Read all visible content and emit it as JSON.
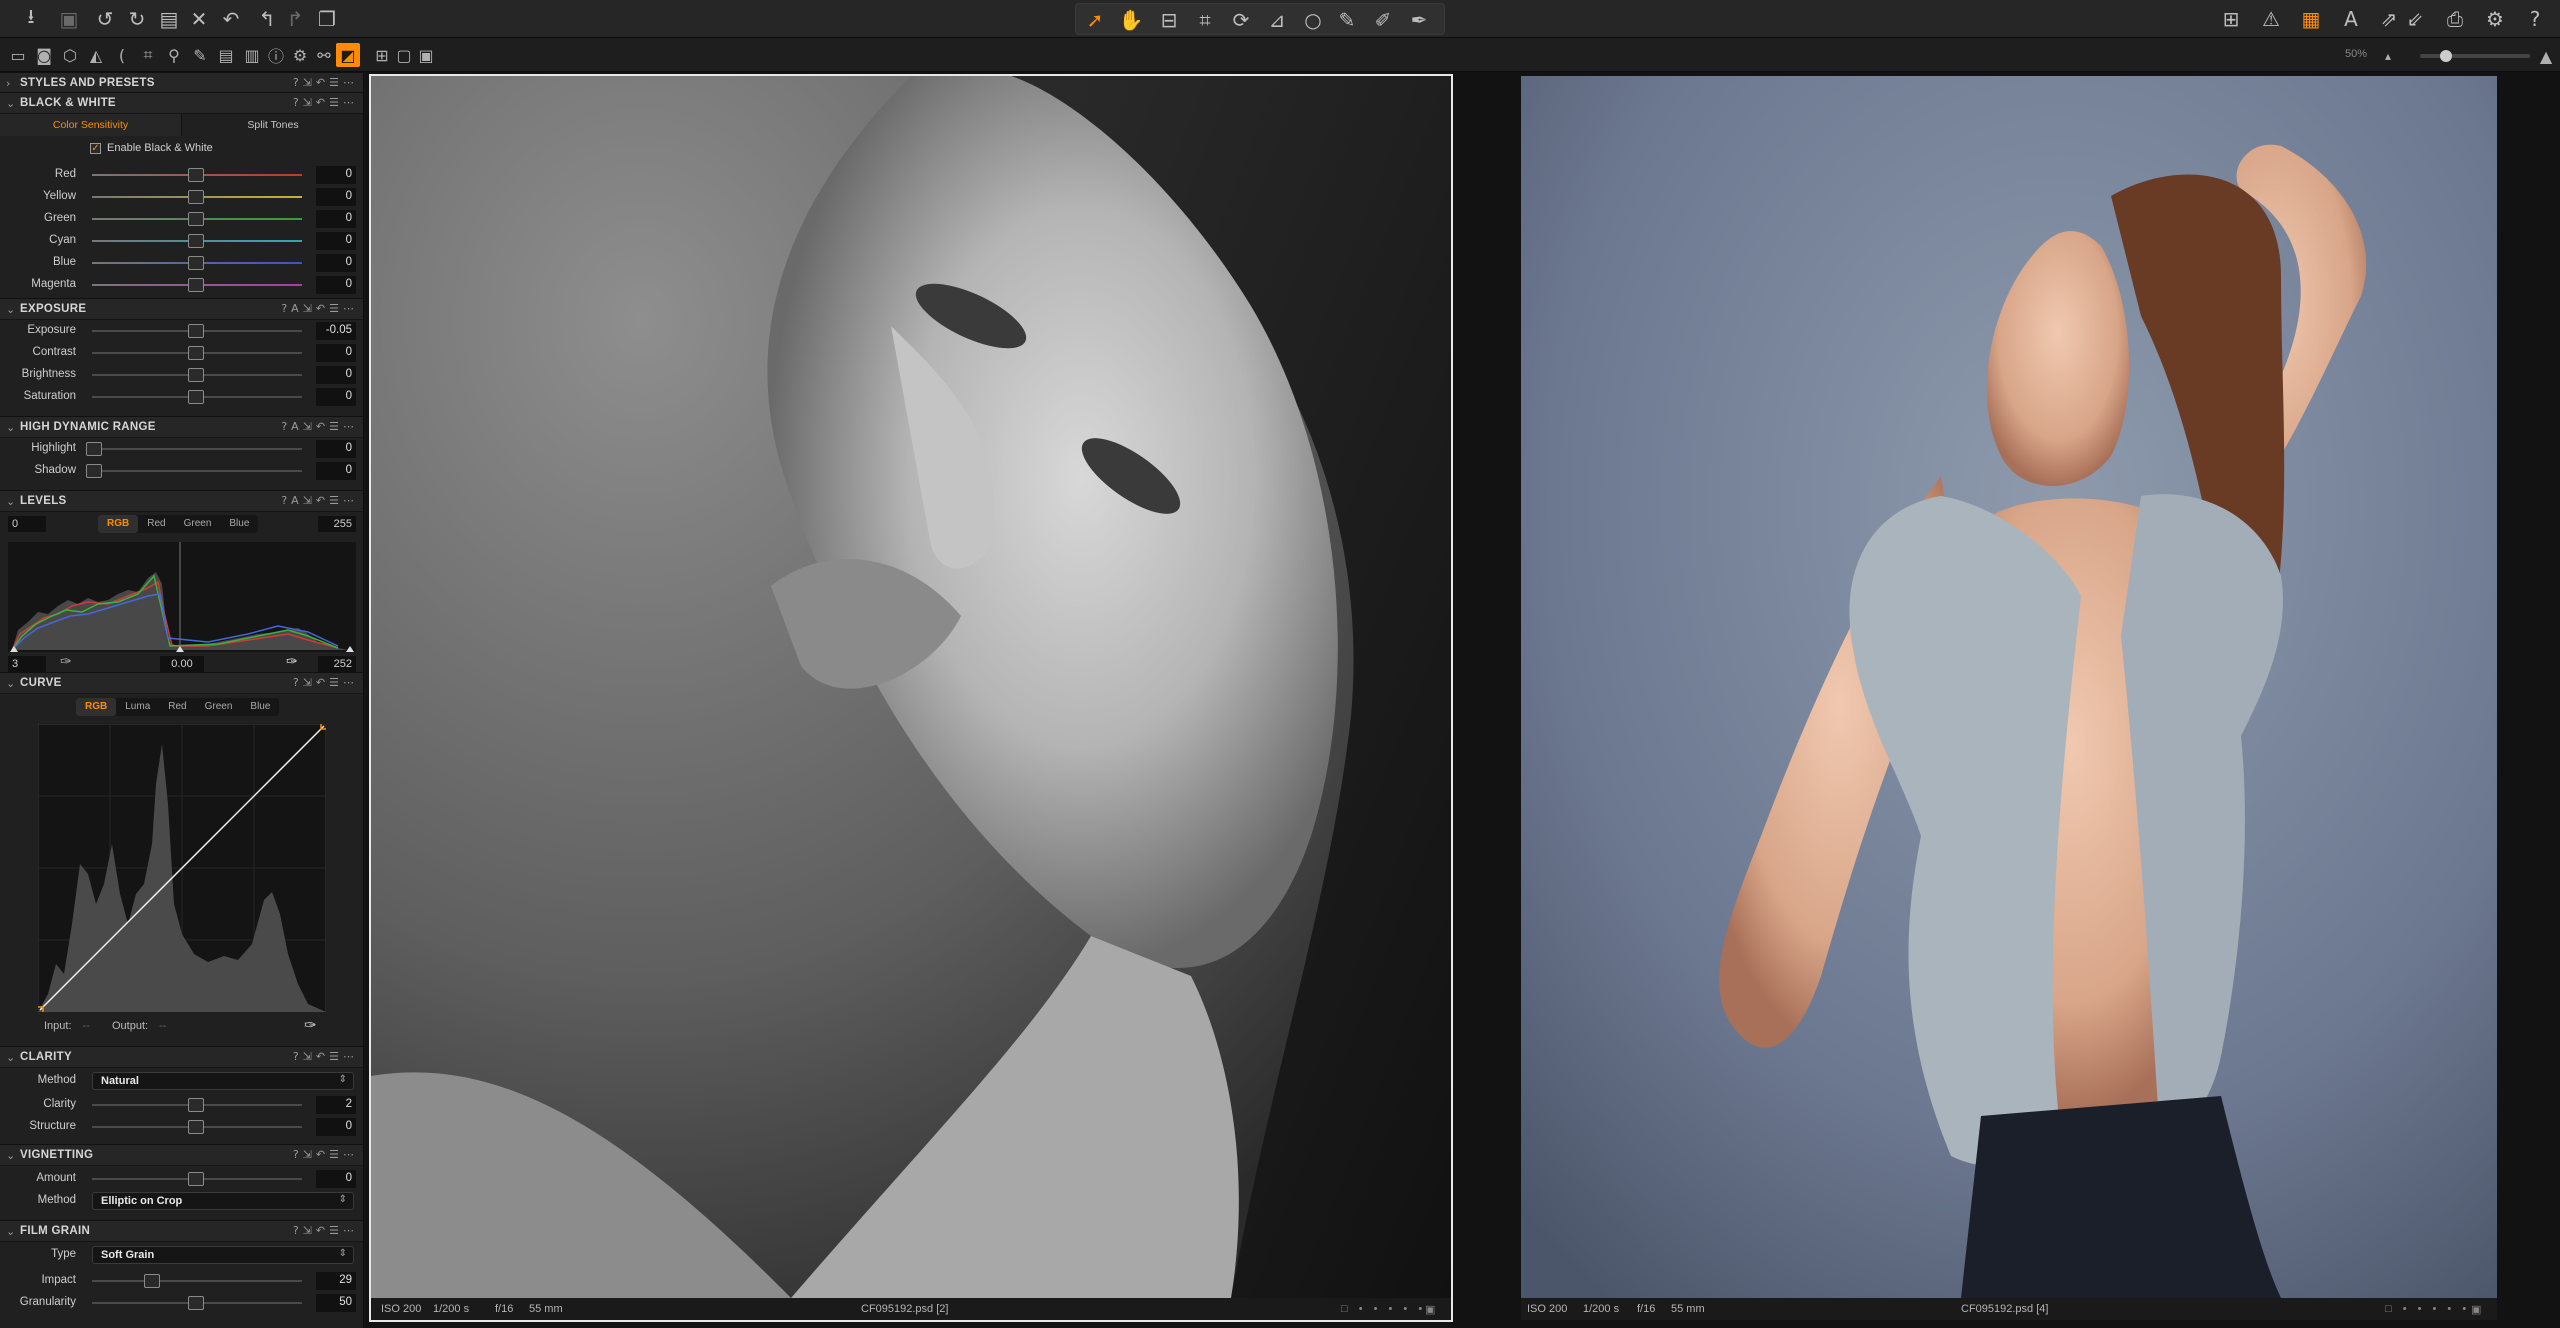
{
  "toolbar": {
    "left_icons": [
      "import-icon",
      "camera-icon",
      "rotate-left-icon",
      "rotate-right-icon",
      "folder-icon",
      "delete-icon",
      "undo-icon",
      "back-icon",
      "forward-icon",
      "duplicate-icon"
    ],
    "cursor_tools": [
      "select-cursor-icon",
      "pan-cursor-icon",
      "straighten-icon",
      "crop-icon",
      "rotate-icon",
      "keystone-icon",
      "spot-icon",
      "brush-icon",
      "eraser-icon",
      "picker-icon"
    ],
    "right_icons": [
      "grid-icon",
      "warning-icon",
      "overlay-icon",
      "text-icon",
      "expand-icon",
      "collapse-icon",
      "print-icon",
      "settings-icon",
      "help-icon"
    ]
  },
  "subbar": {
    "zoom_label": "50%"
  },
  "panel": {
    "styles": {
      "title": "STYLES AND PRESETS"
    },
    "bw": {
      "title": "BLACK & WHITE",
      "tabs": [
        "Color Sensitivity",
        "Split Tones"
      ],
      "enable_label": "Enable Black & White",
      "sliders": [
        {
          "label": "Red",
          "value": "0",
          "color": "#c0392b"
        },
        {
          "label": "Yellow",
          "value": "0",
          "color": "#c9b52b"
        },
        {
          "label": "Green",
          "value": "0",
          "color": "#3c9a3c"
        },
        {
          "label": "Cyan",
          "value": "0",
          "color": "#2fa7b4"
        },
        {
          "label": "Blue",
          "value": "0",
          "color": "#3b55c8"
        },
        {
          "label": "Magenta",
          "value": "0",
          "color": "#b03aa8"
        }
      ]
    },
    "exposure": {
      "title": "EXPOSURE",
      "sliders": [
        {
          "label": "Exposure",
          "value": "-0.05"
        },
        {
          "label": "Contrast",
          "value": "0"
        },
        {
          "label": "Brightness",
          "value": "0"
        },
        {
          "label": "Saturation",
          "value": "0"
        }
      ]
    },
    "hdr": {
      "title": "HIGH DYNAMIC RANGE",
      "sliders": [
        {
          "label": "Highlight",
          "value": "0"
        },
        {
          "label": "Shadow",
          "value": "0"
        }
      ]
    },
    "levels": {
      "title": "LEVELS",
      "left_value": "0",
      "right_value": "255",
      "tabs": [
        "RGB",
        "Red",
        "Green",
        "Blue"
      ],
      "bottom_left": "3",
      "bottom_mid": "0.00",
      "bottom_right": "252"
    },
    "curve": {
      "title": "CURVE",
      "tabs": [
        "RGB",
        "Luma",
        "Red",
        "Green",
        "Blue"
      ],
      "input_label": "Input:",
      "input_value": "--",
      "output_label": "Output:",
      "output_value": "--"
    },
    "clarity": {
      "title": "CLARITY",
      "method_label": "Method",
      "method_value": "Natural",
      "sliders": [
        {
          "label": "Clarity",
          "value": "2"
        },
        {
          "label": "Structure",
          "value": "0"
        }
      ]
    },
    "vignetting": {
      "title": "VIGNETTING",
      "amount_label": "Amount",
      "amount_value": "0",
      "method_label": "Method",
      "method_value": "Elliptic on Crop"
    },
    "grain": {
      "title": "FILM GRAIN",
      "type_label": "Type",
      "type_value": "Soft Grain",
      "sliders": [
        {
          "label": "Impact",
          "value": "29"
        },
        {
          "label": "Granularity",
          "value": "50"
        }
      ]
    }
  },
  "viewer": {
    "left": {
      "iso": "ISO 200",
      "shutter": "1/200 s",
      "aperture": "f/16",
      "focal": "55 mm",
      "filename": "CF095192.psd [2]"
    },
    "right": {
      "iso": "ISO 200",
      "shutter": "1/200 s",
      "aperture": "f/16",
      "focal": "55 mm",
      "filename": "CF095192.psd [4]"
    }
  }
}
